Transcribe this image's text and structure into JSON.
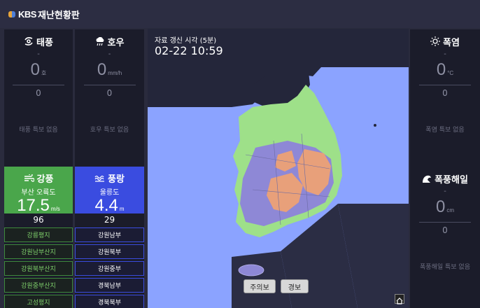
{
  "header": {
    "logo_brand": "KBS",
    "logo_title": "재난현황판"
  },
  "left_cards": [
    {
      "title": "태풍",
      "icon": "typhoon-icon",
      "region": "-",
      "value": "0",
      "unit": "호",
      "count": "0",
      "none_text": "태풍 특보 없음"
    },
    {
      "title": "호우",
      "icon": "rain-icon",
      "region": "-",
      "value": "0",
      "unit": "mm/h",
      "count": "0",
      "none_text": "호우 특보 없음"
    }
  ],
  "active_cards": [
    {
      "title": "강풍",
      "icon": "wind-icon",
      "region": "부산 오륙도",
      "value": "17.5",
      "unit": "m/s",
      "count": "96"
    },
    {
      "title": "풍랑",
      "icon": "wave-icon",
      "region": "울릉도",
      "value": "4.4",
      "unit": "m",
      "count": "29"
    }
  ],
  "wind_list": [
    "강릉평지",
    "강원남부산지",
    "강원북부산지",
    "강원중부산지",
    "고성평지"
  ],
  "wave_list": [
    "강원남부",
    "강원북부",
    "강원중부",
    "경북남부",
    "경북북부"
  ],
  "right_cards": [
    {
      "title": "폭염",
      "icon": "sun-icon",
      "region": "-",
      "value": "0",
      "unit": "°C",
      "count": "0",
      "none_text": "폭염 특보 없음"
    },
    {
      "title": "폭풍해일",
      "icon": "surge-icon",
      "region": "-",
      "value": "0",
      "unit": "cm",
      "count": "0",
      "none_text": "폭풍해일 특보 없음"
    }
  ],
  "map": {
    "time_label": "자료 갱신 시각 (5분)",
    "time_value": "02-22 10:59",
    "btn_advisory": "주의보",
    "btn_warning": "경보"
  },
  "colors": {
    "sea": "#8ba3ff",
    "land_dark": "#24263a",
    "land_green": "#9ee089",
    "advisory_purple": "#8e88d6",
    "warning_orange": "#e8a07a"
  }
}
